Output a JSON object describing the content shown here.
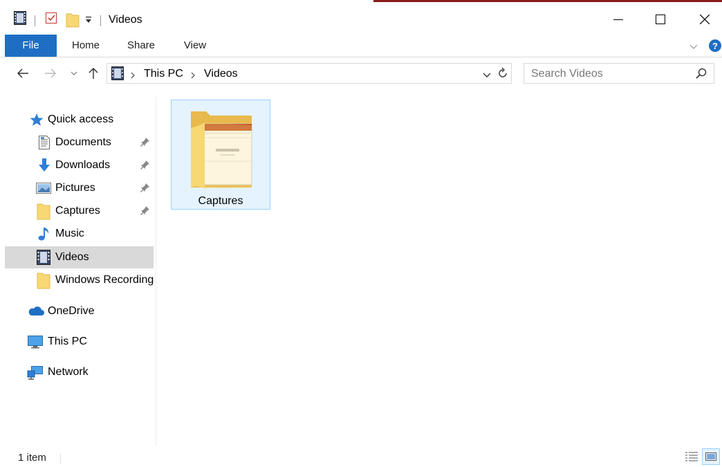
{
  "window": {
    "title": "Videos",
    "buttons": {
      "minimize_icon": "minimize-icon",
      "maximize_icon": "maximize-icon",
      "close_icon": "close-icon"
    }
  },
  "ribbon": {
    "tabs": [
      {
        "label": "File",
        "active": true
      },
      {
        "label": "Home"
      },
      {
        "label": "Share"
      },
      {
        "label": "View"
      }
    ]
  },
  "address": {
    "breadcrumb": [
      "This PC",
      "Videos"
    ],
    "search_placeholder": "Search Videos"
  },
  "nav": {
    "items": [
      {
        "label": "Quick access",
        "icon": "star-icon"
      },
      {
        "label": "Documents",
        "icon": "documents-icon",
        "pinned": true
      },
      {
        "label": "Downloads",
        "icon": "download-icon",
        "pinned": true
      },
      {
        "label": "Pictures",
        "icon": "pictures-icon",
        "pinned": true
      },
      {
        "label": "Captures",
        "icon": "folder-icon",
        "pinned": true
      },
      {
        "label": "Music",
        "icon": "music-icon"
      },
      {
        "label": "Videos",
        "icon": "videos-icon",
        "selected": true
      },
      {
        "label": "Windows Recording",
        "icon": "folder-icon"
      },
      {
        "label": "OneDrive",
        "icon": "cloud-icon"
      },
      {
        "label": "This PC",
        "icon": "computer-icon"
      },
      {
        "label": "Network",
        "icon": "network-icon"
      }
    ]
  },
  "content": {
    "items": [
      {
        "name": "Captures",
        "icon": "folder-icon"
      }
    ]
  },
  "status": {
    "item_count": "1 item"
  },
  "colors": {
    "accent": "#1e6fc4",
    "selection": "#d9d9d9",
    "tile_border": "#99d1ff",
    "folder": "#f8d775"
  }
}
